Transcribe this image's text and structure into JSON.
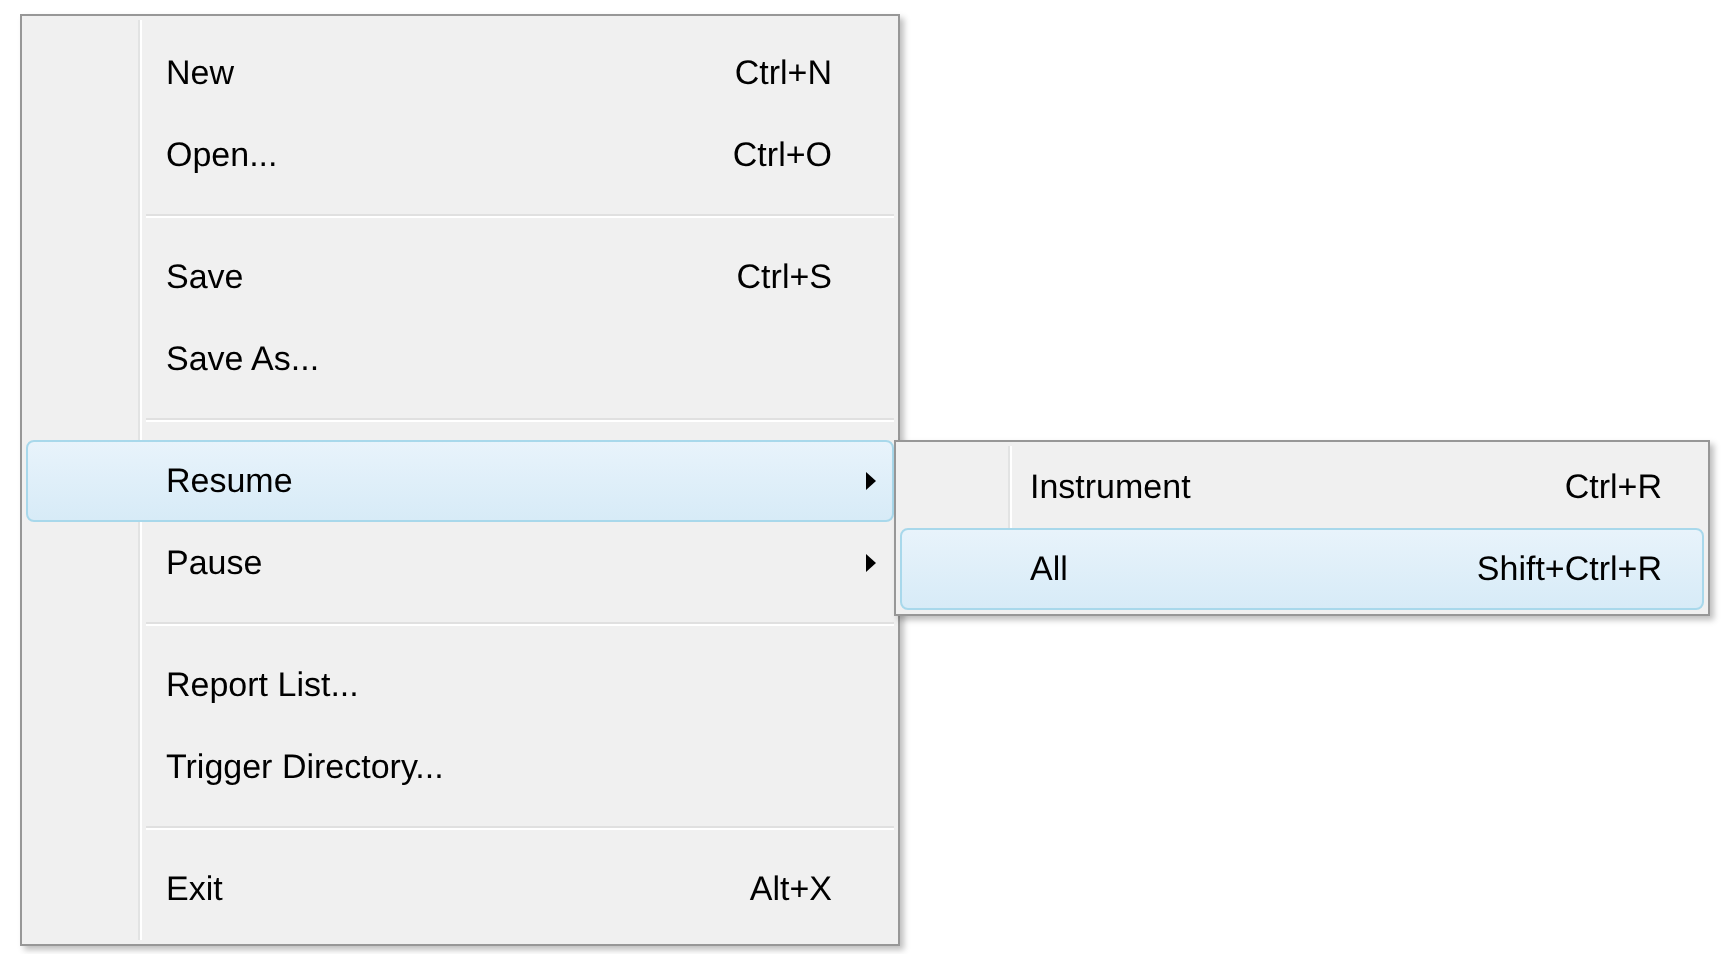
{
  "menu": {
    "items": [
      {
        "kind": "item",
        "label": "New",
        "shortcut": "Ctrl+N",
        "has_submenu": false,
        "selected": false
      },
      {
        "kind": "item",
        "label": "Open...",
        "shortcut": "Ctrl+O",
        "has_submenu": false,
        "selected": false
      },
      {
        "kind": "separator"
      },
      {
        "kind": "item",
        "label": "Save",
        "shortcut": "Ctrl+S",
        "has_submenu": false,
        "selected": false
      },
      {
        "kind": "item",
        "label": "Save As...",
        "has_submenu": false,
        "selected": false
      },
      {
        "kind": "separator"
      },
      {
        "kind": "item",
        "label": "Resume",
        "has_submenu": true,
        "selected": true
      },
      {
        "kind": "item",
        "label": "Pause",
        "has_submenu": true,
        "selected": false
      },
      {
        "kind": "separator"
      },
      {
        "kind": "item",
        "label": "Report List...",
        "has_submenu": false,
        "selected": false
      },
      {
        "kind": "item",
        "label": "Trigger Directory...",
        "has_submenu": false,
        "selected": false
      },
      {
        "kind": "separator"
      },
      {
        "kind": "item",
        "label": "Exit",
        "shortcut": "Alt+X",
        "has_submenu": false,
        "selected": false
      }
    ]
  },
  "submenu": {
    "items": [
      {
        "kind": "item",
        "label": "Instrument",
        "shortcut": "Ctrl+R",
        "has_submenu": false,
        "selected": false
      },
      {
        "kind": "item",
        "label": "All",
        "shortcut": "Shift+Ctrl+R",
        "has_submenu": false,
        "selected": true
      }
    ]
  }
}
